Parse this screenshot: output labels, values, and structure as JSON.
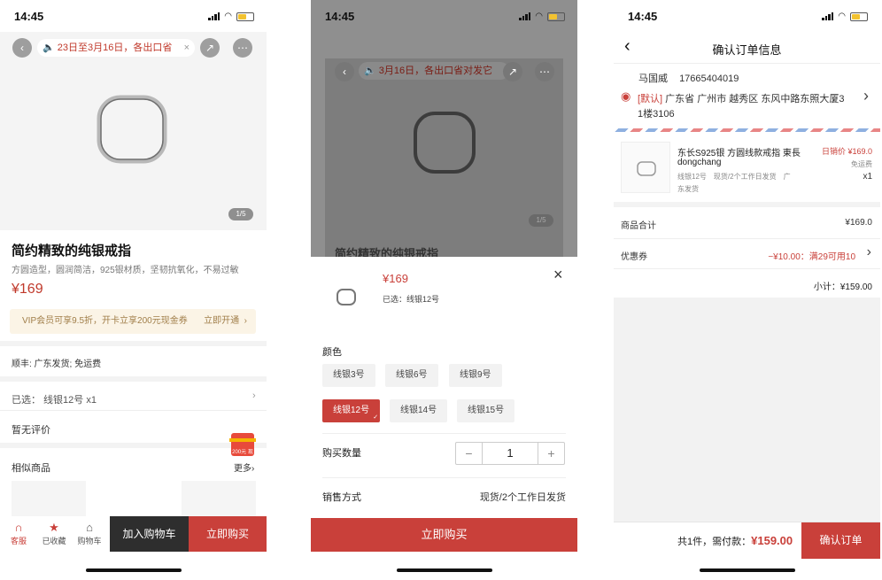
{
  "status": {
    "time": "14:45"
  },
  "screen1": {
    "notice_text": "23日至3月16日，各出口省",
    "close_glyph": "×",
    "pager": "1/5",
    "product_title": "简约精致的纯银戒指",
    "product_desc": "方圆造型，圆润简洁，925银材质，坚韧抗氧化，不易过敏",
    "price": "¥169",
    "vip_text": "VIP会员可享9.5折，开卡立享200元现金券",
    "vip_action": "立即开通",
    "shipping": "顺丰: 广东发货; 免运费",
    "selected": "已选： 线银12号 x1",
    "no_reviews": "暂无评价",
    "similar_title": "相似商品",
    "more": "更多",
    "gift_text": "200元 现金券",
    "tabs": [
      {
        "label": "客服",
        "icon": "headset-icon"
      },
      {
        "label": "已收藏",
        "icon": "star-icon"
      },
      {
        "label": "购物车",
        "icon": "cart-icon"
      }
    ],
    "add_to_cart": "加入购物车",
    "buy_now": "立即购买"
  },
  "screen2": {
    "notice_text": "3月16日，各出口省对发它",
    "pager": "1/5",
    "bg_title": "简约精致的纯银戒指",
    "price": "¥169",
    "selected": "已选：线银12号",
    "close_glyph": "×",
    "color_label": "颜色",
    "options": [
      "线银3号",
      "线银6号",
      "线银9号",
      "线银12号",
      "线银14号",
      "线银15号"
    ],
    "selected_option": "线银12号",
    "qty_label": "购买数量",
    "qty": "1",
    "minus": "−",
    "plus": "+",
    "sale_label": "销售方式",
    "sale_value": "现货/2个工作日发货",
    "buy_now": "立即购买"
  },
  "screen3": {
    "title": "确认订单信息",
    "name": "马国威",
    "phone": "17665404019",
    "address_tag": "[默认]",
    "address": " 广东省 广州市 越秀区 东风中路东照大厦3",
    "address_line2": "1楼3106",
    "item_name": "东长S925银 方圆线款戒指 東長",
    "item_brand": "dongchang",
    "item_price": "日销价 ¥169.0",
    "item_free": "免运费",
    "item_spec": "线银12号　现货/2个工作日发货　广",
    "item_spec2": "东发货",
    "item_qty": "x1",
    "goods_total_label": "商品合计",
    "goods_total": "¥169.0",
    "coupon_label": "优惠券",
    "coupon_value": "−¥10.00：满29可用10",
    "subtotal": "小计：¥159.00",
    "footer_prefix": "共1件，需付款：",
    "footer_total": "¥159.00",
    "confirm": "确认订单"
  },
  "colors": {
    "accent": "#c9403a",
    "gold": "#a07e49"
  }
}
